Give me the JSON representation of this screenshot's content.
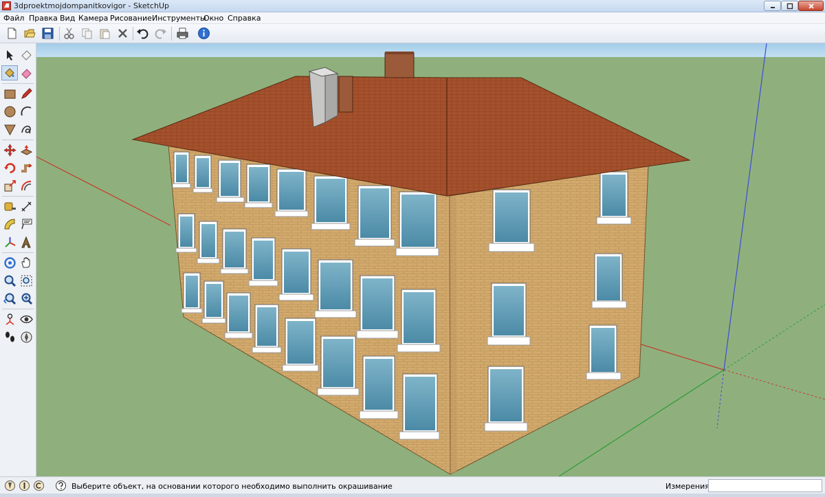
{
  "window": {
    "title": "3dproektmojdompanitkovigor - SketchUp"
  },
  "menu": {
    "items": [
      {
        "label": "Файл"
      },
      {
        "label": "Правка"
      },
      {
        "label": "Вид"
      },
      {
        "label": "Камера"
      },
      {
        "label": "Рисование"
      },
      {
        "label": "Инструменты"
      },
      {
        "label": "Окно"
      },
      {
        "label": "Справка"
      }
    ]
  },
  "toolbar": {
    "buttons": [
      "new-icon",
      "open-icon",
      "save-icon",
      "cut-icon",
      "copy-icon",
      "paste-icon",
      "erase-icon",
      "undo-icon",
      "redo-icon",
      "print-icon",
      "model-info-icon"
    ]
  },
  "tools": [
    "select-icon",
    "eraser-icon",
    "paint-bucket-icon",
    "eraser-pink-icon",
    "rectangle-icon",
    "pencil-icon",
    "circle-icon",
    "arc-icon",
    "polygon-icon",
    "freehand-icon",
    "move-icon",
    "push-pull-icon",
    "rotate-icon",
    "follow-me-icon",
    "scale-icon",
    "offset-icon",
    "tape-measure-icon",
    "dimension-icon",
    "protractor-icon",
    "text-icon",
    "axes-icon",
    "3d-text-icon",
    "orbit-icon",
    "pan-icon",
    "zoom-icon",
    "zoom-window-icon",
    "previous-icon",
    "zoom-extents-icon",
    "position-camera-icon",
    "look-around-icon",
    "walk-icon",
    "section-plane-icon"
  ],
  "colors": {
    "sky": "#a3cbe8",
    "ground": "#8fb07c",
    "roof": "#a5512d",
    "wall": "#d3aa6d",
    "chimney_brick": "#9b5a39",
    "chimney_grey": "#c6c6c4",
    "axis_red": "#c43a2f",
    "axis_green": "#2e9b3a",
    "axis_blue": "#3d4bd8"
  },
  "status": {
    "hint": "Выберите объект, на основании которого необходимо выполнить окрашивание",
    "measure_label": "Измерения",
    "measure_value": ""
  }
}
